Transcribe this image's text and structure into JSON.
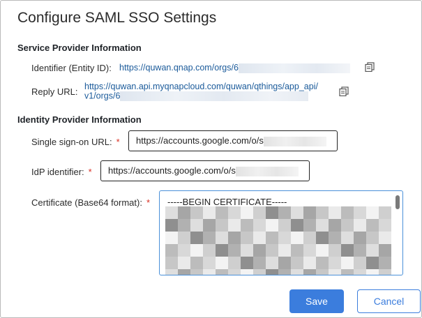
{
  "dialog": {
    "title": "Configure SAML SSO Settings",
    "sp_section": "Service Provider Information",
    "identifier_label": "Identifier (Entity ID):",
    "identifier_value": "https://quwan.qnap.com/orgs/6",
    "reply_label": "Reply URL:",
    "reply_value_line1": "https://quwan.api.myqnapcloud.com/quwan/qthings/app_api/",
    "reply_value_line2": "v1/orgs/6",
    "idp_section": "Identity Provider Information",
    "sso_url_label": "Single sign-on URL:",
    "sso_url_value": "https://accounts.google.com/o/s",
    "idp_identifier_label": "IdP identifier:",
    "idp_identifier_value": "https://accounts.google.com/o/s",
    "cert_label": "Certificate (Base64 format):",
    "cert_head": "-----BEGIN CERTIFICATE-----",
    "required_marker": "*",
    "save_label": "Save",
    "cancel_label": "Cancel"
  },
  "icons": {
    "copy": "copy-icon"
  },
  "colors": {
    "accent": "#3b7ddd",
    "link": "#1a5a9a",
    "required": "#d93025",
    "textarea_border": "#4a90d9"
  }
}
